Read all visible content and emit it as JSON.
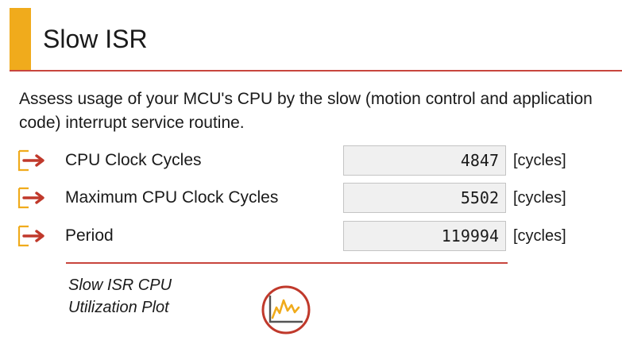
{
  "header": {
    "title": "Slow ISR"
  },
  "description": "Assess usage of your MCU's CPU by the slow (motion control and application code) interrupt service routine.",
  "parameters": [
    {
      "label": "CPU Clock Cycles",
      "value": "4847",
      "unit": "[cycles]",
      "icon": "arrow-right-icon"
    },
    {
      "label": "Maximum CPU Clock Cycles",
      "value": "5502",
      "unit": "[cycles]",
      "icon": "arrow-right-icon"
    },
    {
      "label": "Period",
      "value": "119994",
      "unit": "[cycles]",
      "icon": "arrow-right-icon"
    }
  ],
  "plot": {
    "label": "Slow ISR CPU Utilization Plot",
    "icon": "line-chart-icon"
  },
  "colors": {
    "accent": "#f0ab1c",
    "rule": "#c8453d",
    "arrow": "#c0392b",
    "icon_frame": "#f0ab1c"
  }
}
